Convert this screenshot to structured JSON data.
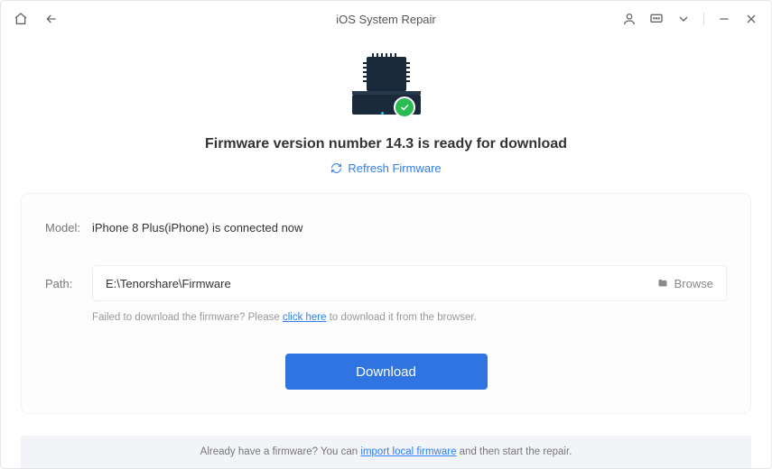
{
  "titlebar": {
    "title": "iOS System Repair"
  },
  "heading": "Firmware version number 14.3 is ready for download",
  "refresh_label": "Refresh Firmware",
  "card": {
    "model_label": "Model:",
    "model_value": "iPhone 8 Plus(iPhone) is connected now",
    "path_label": "Path:",
    "path_value": "E:\\Tenorshare\\Firmware",
    "browse_label": "Browse",
    "hint_pre": "Failed to download the firmware? Please ",
    "hint_link": "click here",
    "hint_post": " to download it from the browser.",
    "download_label": "Download"
  },
  "footer": {
    "pre": "Already have a firmware? You can ",
    "link": "import local firmware",
    "post": " and then start the repair."
  }
}
